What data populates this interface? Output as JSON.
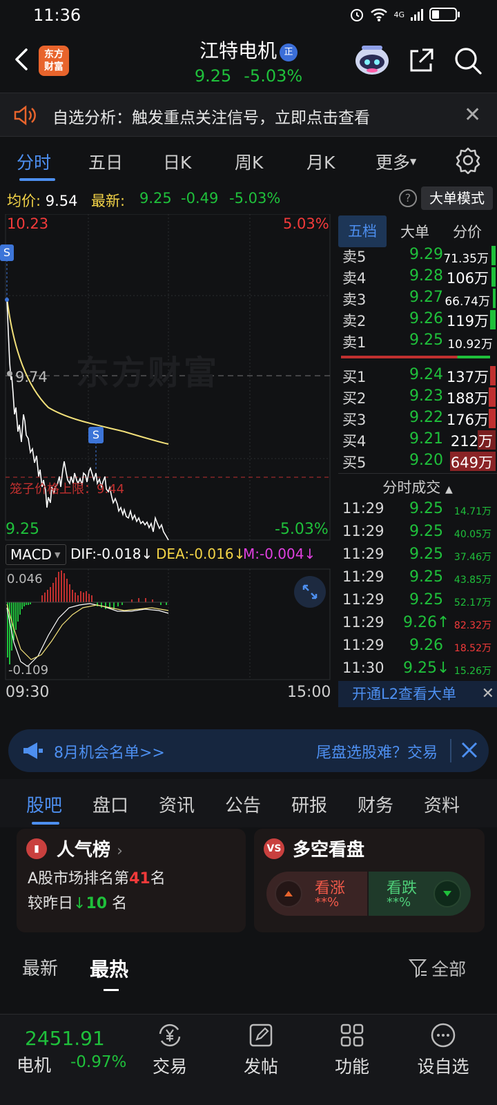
{
  "status_bar": {
    "time": "11:36",
    "network": "4G"
  },
  "header": {
    "logo_text_line1": "东方",
    "logo_text_line2": "财富",
    "stock_name": "江特电机",
    "badge": "正",
    "price": "9.25",
    "change_pct": "-5.03%"
  },
  "notice": {
    "text": "自选分析：触发重点关注信号，立即点击查看"
  },
  "period_tabs": [
    "分时",
    "五日",
    "日K",
    "周K",
    "月K",
    "更多"
  ],
  "avg_line": {
    "avg_label": "均价:",
    "avg_value": "9.54",
    "latest_label": "最新:",
    "latest_value": "9.25",
    "change": "-0.49",
    "change_pct": "-5.03%",
    "help": "?",
    "mode_button": "大单模式"
  },
  "chart": {
    "high_price": "10.23",
    "high_pct": "5.03%",
    "low_price": "9.25",
    "low_pct": "-5.03%",
    "mid_price": "9.74",
    "watermark": "东方财富",
    "cage_label": "笼子价格上限：9.44",
    "signal_marker": "S",
    "time_start": "09:30",
    "time_end": "15:00",
    "colors": {
      "price_line": "#ffffff",
      "avg_line": "#f2e07a",
      "up": "#f23a3a",
      "down": "#1fc03b"
    }
  },
  "macd": {
    "name": "MACD",
    "dif": "DIF:-0.018↓",
    "dea": "DEA:-0.016↓",
    "m": "M:-0.004↓",
    "top_value": "0.046",
    "bottom_value": "-0.109"
  },
  "orderbook": {
    "tabs": [
      "五档",
      "大单",
      "分价"
    ],
    "asks": [
      {
        "label": "卖5",
        "price": "9.29",
        "vol": "71.35万"
      },
      {
        "label": "卖4",
        "price": "9.28",
        "vol": "106万"
      },
      {
        "label": "卖3",
        "price": "9.27",
        "vol": "66.74万"
      },
      {
        "label": "卖2",
        "price": "9.26",
        "vol": "119万"
      },
      {
        "label": "卖1",
        "price": "9.25",
        "vol": "10.92万"
      }
    ],
    "bids": [
      {
        "label": "买1",
        "price": "9.24",
        "vol": "137万"
      },
      {
        "label": "买2",
        "price": "9.23",
        "vol": "188万"
      },
      {
        "label": "买3",
        "price": "9.22",
        "vol": "176万"
      },
      {
        "label": "买4",
        "price": "9.21",
        "vol": "212万"
      },
      {
        "label": "买5",
        "price": "9.20",
        "vol": "649万"
      }
    ],
    "trades_title": "分时成交",
    "trades": [
      {
        "time": "11:29",
        "price": "9.25",
        "vol": "14.71万",
        "dir": "down"
      },
      {
        "time": "11:29",
        "price": "9.25",
        "vol": "40.05万",
        "dir": "down"
      },
      {
        "time": "11:29",
        "price": "9.25",
        "vol": "37.46万",
        "dir": "down"
      },
      {
        "time": "11:29",
        "price": "9.25",
        "vol": "43.85万",
        "dir": "down"
      },
      {
        "time": "11:29",
        "price": "9.25",
        "vol": "52.17万",
        "dir": "down"
      },
      {
        "time": "11:29",
        "price": "9.26↑",
        "vol": "82.32万",
        "dir": "up"
      },
      {
        "time": "11:29",
        "price": "9.26",
        "vol": "18.52万",
        "dir": "up"
      },
      {
        "time": "11:30",
        "price": "9.25↓",
        "vol": "15.26万",
        "dir": "down"
      }
    ],
    "l2_banner": "开通L2查看大单"
  },
  "promo": {
    "left_text": "8月机会名单>>",
    "right_text": "尾盘选股难？交易"
  },
  "section_tabs": [
    "股吧",
    "盘口",
    "资讯",
    "公告",
    "研报",
    "财务",
    "资料"
  ],
  "popularity_card": {
    "title": "人气榜",
    "line1_prefix": "A股市场排名第",
    "rank": "41",
    "line1_suffix": "名",
    "line2_prefix": "较昨日",
    "delta": "10",
    "line2_suffix": "名"
  },
  "bullbear_card": {
    "title": "多空看盘",
    "up_label": "看涨",
    "up_value": "**%",
    "down_label": "看跌",
    "down_value": "**%"
  },
  "feed_tabs": {
    "latest": "最新",
    "hot": "最热",
    "filter": "全部"
  },
  "bottom_bar": {
    "index_value": "2451.91",
    "index_name": "电机",
    "index_change": "-0.97%",
    "items": [
      "交易",
      "发帖",
      "功能",
      "设自选"
    ]
  }
}
